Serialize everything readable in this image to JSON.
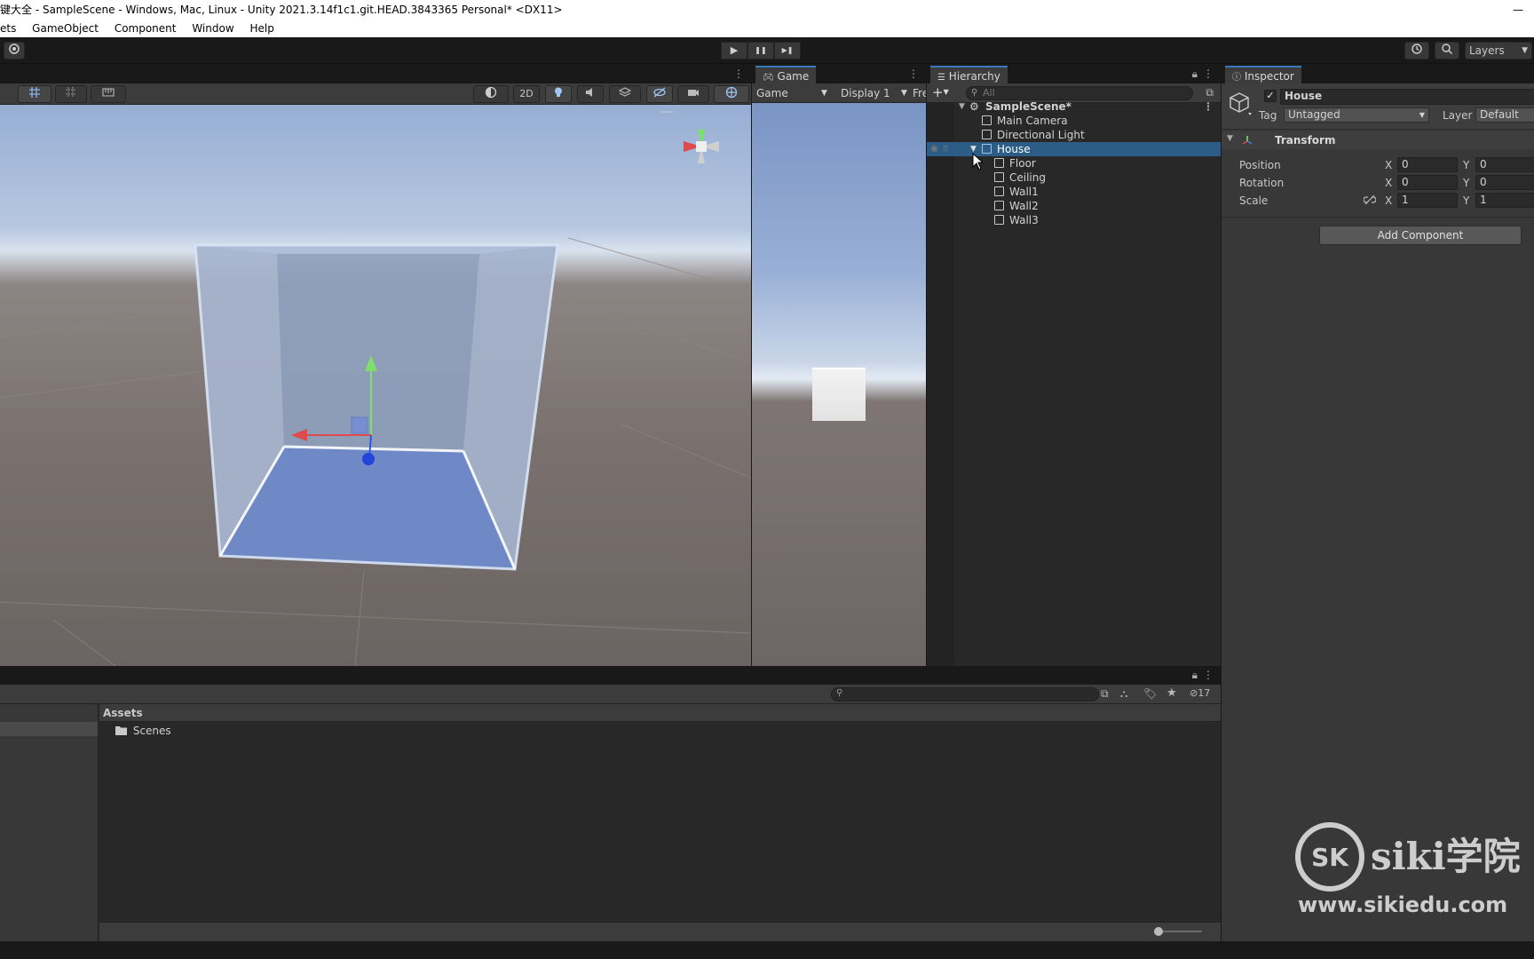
{
  "window": {
    "title": "键大全 - SampleScene - Windows, Mac, Linux - Unity 2021.3.14f1c1.git.HEAD.3843365 Personal* <DX11>",
    "minimize_glyph": "—"
  },
  "menu": [
    "ets",
    "GameObject",
    "Component",
    "Window",
    "Help"
  ],
  "toolbar": {
    "layers_label": "Layers",
    "play_glyph": "▶",
    "pause_glyph": "❚❚",
    "step_glyph": "▶❚"
  },
  "scene": {
    "mode_2d": "2D"
  },
  "game": {
    "tab_label": "Game",
    "view_mode": "Game",
    "display": "Display 1",
    "aspect": "Fre"
  },
  "hierarchy": {
    "tab_label": "Hierarchy",
    "add_glyph": "+",
    "search_placeholder": "All",
    "rows": [
      {
        "label": "SampleScene*",
        "depth": 0,
        "kind": "scene"
      },
      {
        "label": "Main Camera",
        "depth": 1,
        "kind": "object"
      },
      {
        "label": "Directional Light",
        "depth": 1,
        "kind": "object"
      },
      {
        "label": "House",
        "depth": 1,
        "kind": "object",
        "selected": true
      },
      {
        "label": "Floor",
        "depth": 2,
        "kind": "object"
      },
      {
        "label": "Ceiling",
        "depth": 2,
        "kind": "object"
      },
      {
        "label": "Wall1",
        "depth": 2,
        "kind": "object"
      },
      {
        "label": "Wall2",
        "depth": 2,
        "kind": "object"
      },
      {
        "label": "Wall3",
        "depth": 2,
        "kind": "object"
      }
    ]
  },
  "inspector": {
    "tab_label": "Inspector",
    "object_name": "House",
    "active": true,
    "tag_label": "Tag",
    "tag_value": "Untagged",
    "layer_label": "Layer",
    "layer_value": "Default",
    "transform_label": "Transform",
    "position_label": "Position",
    "rotation_label": "Rotation",
    "scale_label": "Scale",
    "x_label": "X",
    "y_label": "Y",
    "position": {
      "x": "0",
      "y": "0"
    },
    "rotation": {
      "x": "0",
      "y": "0"
    },
    "scale": {
      "x": "1",
      "y": "1"
    },
    "add_component_label": "Add Component"
  },
  "project": {
    "breadcrumb": "Assets",
    "folders": [
      "Scenes"
    ],
    "hidden_count": "17"
  },
  "watermark": {
    "brand": "siki学院",
    "url": "www.sikiedu.com"
  },
  "colors": {
    "selection": "#2c5d87",
    "accent_tab": "#3a79bb",
    "panel_bg": "#282828",
    "inspector_bg": "#383838"
  }
}
